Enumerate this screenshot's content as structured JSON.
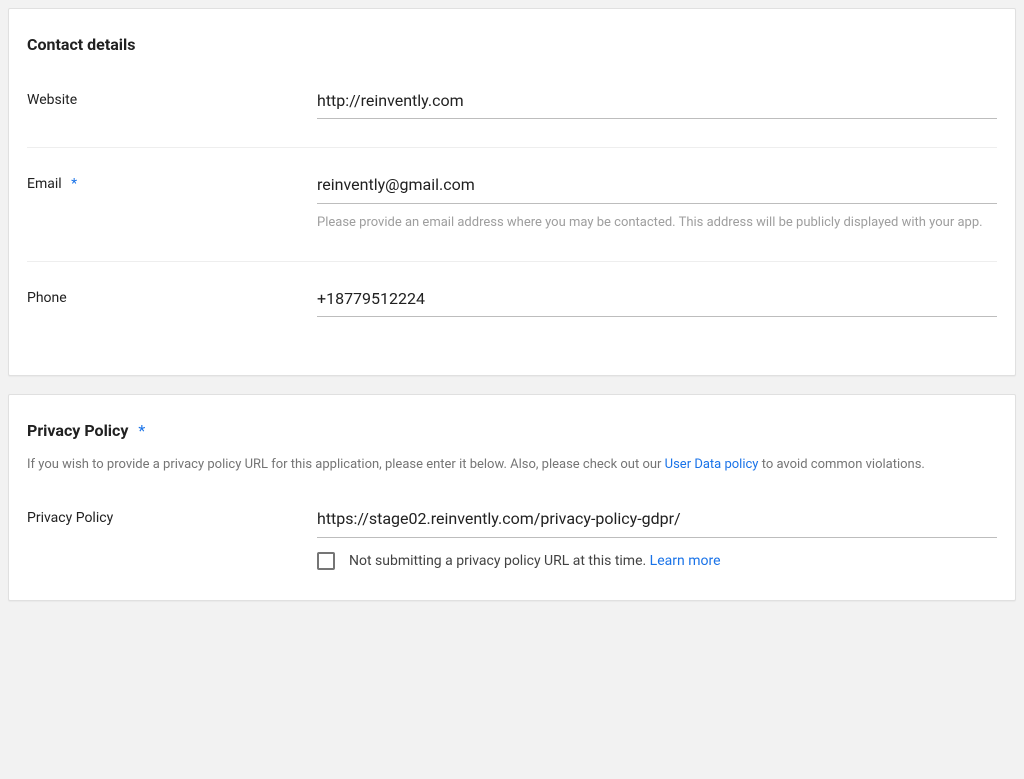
{
  "contact": {
    "title": "Contact details",
    "website_label": "Website",
    "website_value": "http://reinvently.com",
    "email_label": "Email",
    "email_value": "reinvently@gmail.com",
    "email_hint": "Please provide an email address where you may be contacted. This address will be publicly displayed with your app.",
    "phone_label": "Phone",
    "phone_value": "+18779512224"
  },
  "privacy": {
    "title": "Privacy Policy",
    "desc_pre": "If you wish to provide a privacy policy URL for this application, please enter it below. Also, please check out our ",
    "desc_link": "User Data policy",
    "desc_post": " to avoid common violations.",
    "field_label": "Privacy Policy",
    "url_value": "https://stage02.reinvently.com/privacy-policy-gdpr/",
    "optout_text": "Not submitting a privacy policy URL at this time. ",
    "optout_link": "Learn more"
  },
  "star": "*"
}
